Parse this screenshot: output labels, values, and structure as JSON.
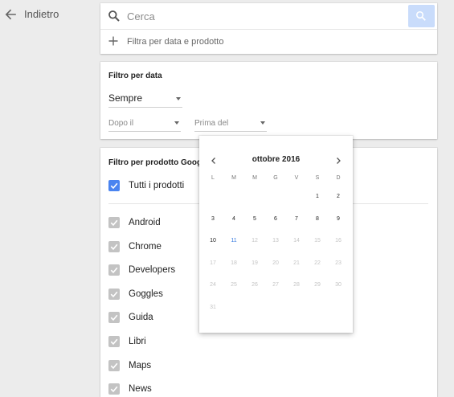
{
  "back": {
    "label": "Indietro"
  },
  "search": {
    "placeholder": "Cerca",
    "value": "",
    "add_filter_label": "Filtra per data e prodotto"
  },
  "date_filter": {
    "title": "Filtro per data",
    "range_select": "Sempre",
    "after_placeholder": "Dopo il",
    "before_placeholder": "Prima del"
  },
  "product_filter": {
    "title": "Filtro per prodotto Google",
    "all_label": "Tutti i prodotti",
    "products": [
      "Android",
      "Chrome",
      "Developers",
      "Goggles",
      "Guida",
      "Libri",
      "Maps",
      "News"
    ]
  },
  "calendar": {
    "title": "ottobre 2016",
    "weekdays": [
      "L",
      "M",
      "M",
      "G",
      "V",
      "S",
      "D"
    ],
    "weeks": [
      [
        "",
        "",
        "",
        "",
        "",
        "1",
        "2"
      ],
      [
        "3",
        "4",
        "5",
        "6",
        "7",
        "8",
        "9"
      ],
      [
        "10",
        "11",
        "12",
        "13",
        "14",
        "15",
        "16"
      ],
      [
        "17",
        "18",
        "19",
        "20",
        "21",
        "22",
        "23"
      ],
      [
        "24",
        "25",
        "26",
        "27",
        "28",
        "29",
        "30"
      ],
      [
        "31",
        "",
        "",
        "",
        "",
        "",
        ""
      ]
    ],
    "last_enabled_day": "10",
    "today": "11"
  },
  "colors": {
    "accent": "#4a84f0",
    "search_button": "#c9dcfb",
    "today": "#3a7de0",
    "disabled_day": "#c4c4c4",
    "checkbox_disabled": "#c3c3c3",
    "page_background": "#ececec"
  },
  "icons": {
    "back": "arrow-left-icon",
    "search": "search-icon",
    "add": "plus-icon",
    "prev_month": "chevron-left-icon",
    "next_month": "chevron-right-icon",
    "check": "check-icon",
    "dropdown": "triangle-down-icon"
  }
}
